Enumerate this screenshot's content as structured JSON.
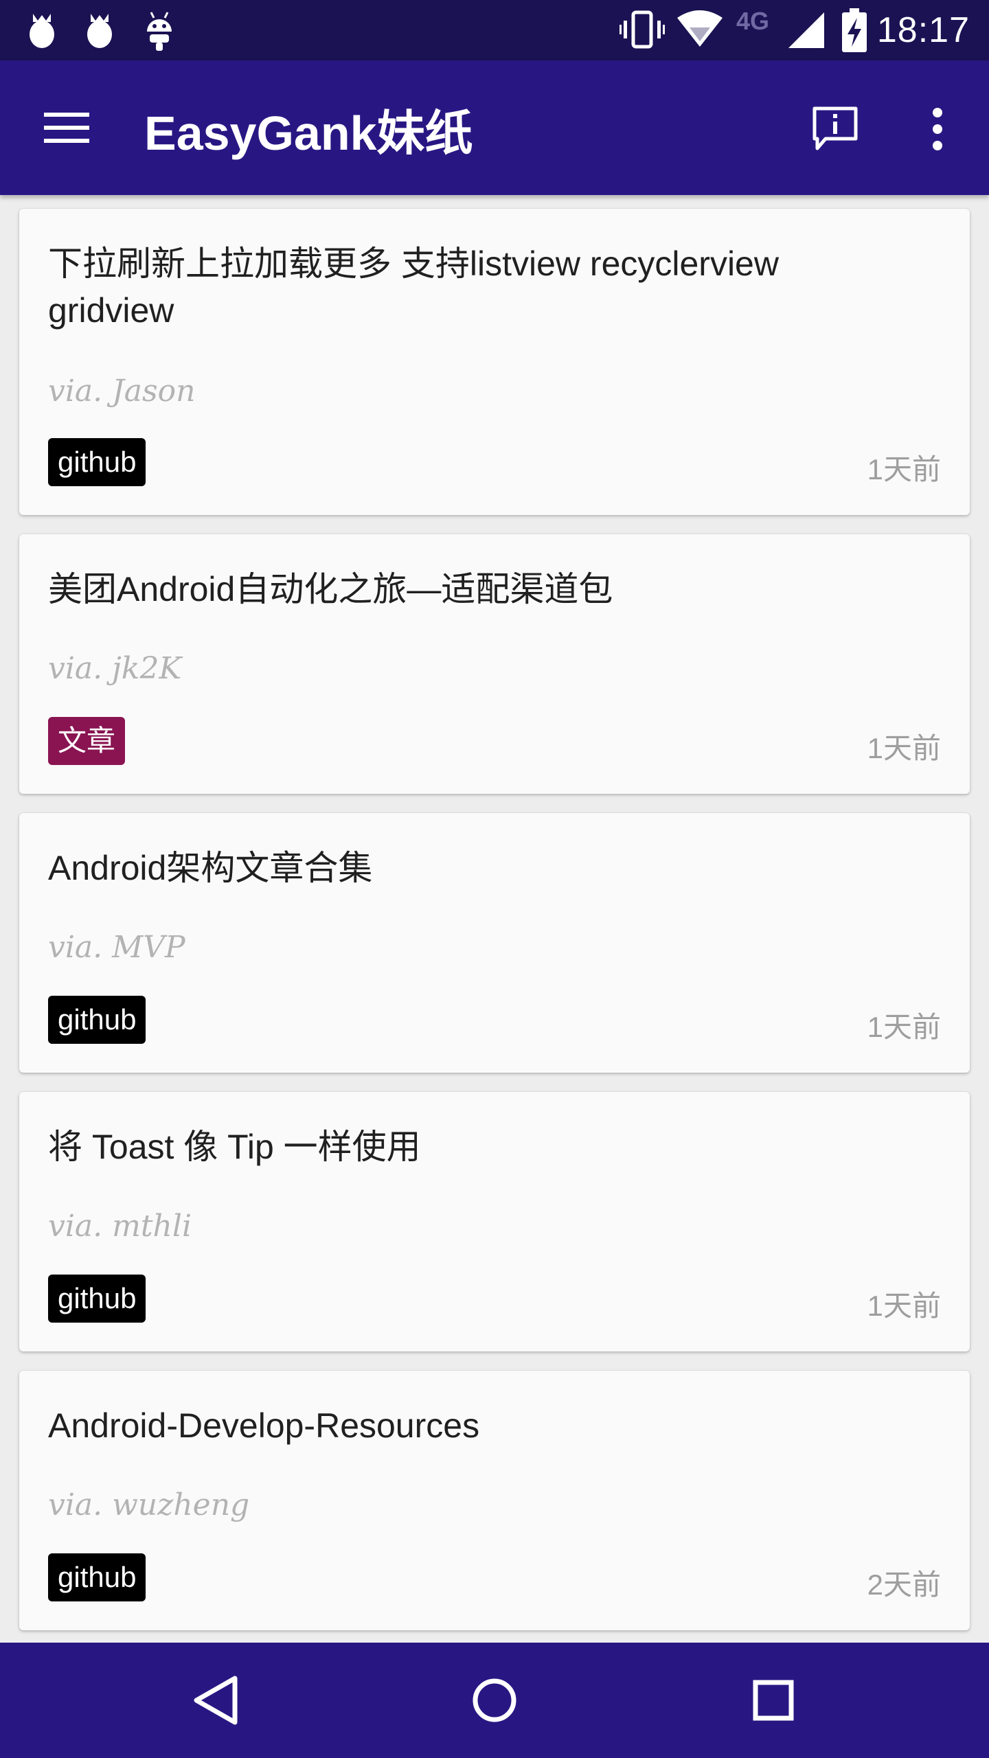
{
  "status_bar": {
    "notifications": [
      "notification-icon",
      "notification-icon",
      "android-icon"
    ],
    "network": "4G",
    "time": "18:17"
  },
  "app_bar": {
    "title": "EasyGank妹纸",
    "background": "#281783"
  },
  "feed": [
    {
      "title": "下拉刷新上拉加载更多 支持listview recyclerview gridview",
      "via": "via. Jason",
      "tag": "github",
      "tag_color": "#000000",
      "time": "1天前"
    },
    {
      "title": "美团Android自动化之旅—适配渠道包",
      "via": "via. jk2K",
      "tag": "文章",
      "tag_color": "#8a1452",
      "time": "1天前"
    },
    {
      "title": "Android架构文章合集",
      "via": "via. MVP",
      "tag": "github",
      "tag_color": "#000000",
      "time": "1天前"
    },
    {
      "title": "将 Toast 像 Tip 一样使用",
      "via": "via. mthli",
      "tag": "github",
      "tag_color": "#000000",
      "time": "1天前"
    },
    {
      "title": "Android-Develop-Resources",
      "via": "via. wuzheng",
      "tag": "github",
      "tag_color": "#000000",
      "time": "2天前"
    }
  ],
  "nav_bar": {
    "buttons": [
      "back-icon",
      "home-icon",
      "recents-icon"
    ]
  }
}
